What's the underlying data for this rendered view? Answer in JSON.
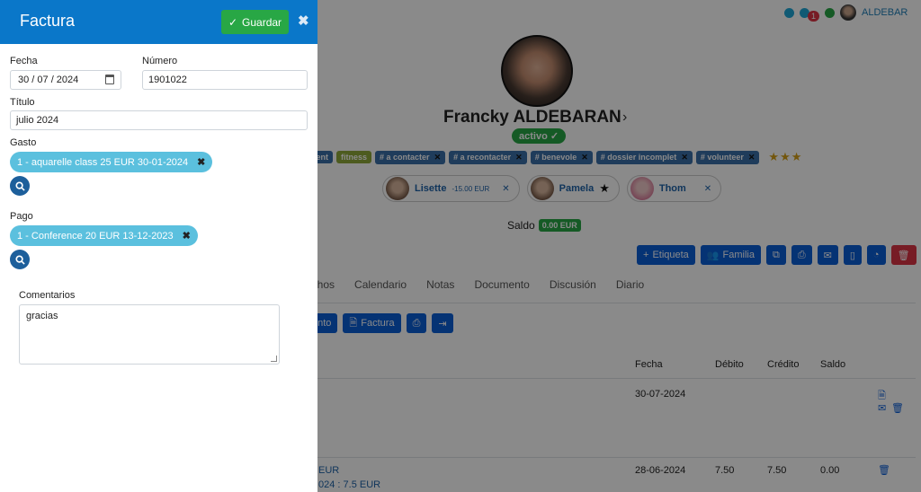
{
  "panel": {
    "title": "Factura",
    "save_label": "Guardar",
    "close_glyph": "✖",
    "fields": {
      "fecha_label": "Fecha",
      "fecha_value": "30 / 07 / 2024",
      "numero_label": "Número",
      "numero_value": "1901022",
      "titulo_label": "Título",
      "titulo_value": "julio 2024",
      "gasto_label": "Gasto",
      "gasto_chip": "1 - aquarelle class 25 EUR 30-01-2024",
      "pago_label": "Pago",
      "pago_chip": "1 - Conference 20 EUR 13-12-2023",
      "comentarios_label": "Comentarios",
      "comentarios_value": "gracias"
    }
  },
  "profile": {
    "name": "Francky ALDEBARAN",
    "status": "activo ✓",
    "tags": [
      {
        "label": "erent",
        "kind": "blue"
      },
      {
        "label": "fitness",
        "kind": "lime"
      },
      {
        "label": "# a contacter",
        "kind": "blue"
      },
      {
        "label": "# a recontacter",
        "kind": "blue"
      },
      {
        "label": "# benevole",
        "kind": "blue"
      },
      {
        "label": "# dossier incomplet",
        "kind": "blue"
      },
      {
        "label": "# volunteer",
        "kind": "blue"
      }
    ],
    "stars": "★★★",
    "relations": [
      {
        "name": "Lisette",
        "extra": "-15.00 EUR"
      },
      {
        "name": "Pamela",
        "extra": "★"
      },
      {
        "name": "Thom",
        "extra": ""
      }
    ],
    "saldo_label": "Saldo",
    "saldo_value": "0.00 EUR"
  },
  "topbar": {
    "notification_count": "1",
    "user_text": "ALDEBAR"
  },
  "actions": {
    "etiqueta": "Etiqueta",
    "familia": "Familia"
  },
  "tabs": [
    "echos",
    "Calendario",
    "Notas",
    "Documento",
    "Discusión",
    "Diario"
  ],
  "sub_actions": {
    "evento": "ento",
    "factura": "Factura"
  },
  "ledger": {
    "headers": {
      "fecha": "Fecha",
      "debito": "Débito",
      "credito": "Crédito",
      "saldo": "Saldo"
    },
    "rows": [
      {
        "fecha": "30-07-2024",
        "debito": "",
        "credito": "",
        "saldo": "",
        "desc1": "",
        "desc2": ""
      },
      {
        "fecha": "28-06-2024",
        "debito": "7.50",
        "credito": "7.50",
        "saldo": "0.00",
        "desc1": "EUR",
        "desc2": "024 : 7.5 EUR"
      }
    ]
  },
  "colors": {
    "panel_header": "#0a77c9",
    "save_button": "#28a745",
    "chip": "#5bc0de",
    "primary": "#0b5ed7",
    "danger": "#dc3545"
  }
}
